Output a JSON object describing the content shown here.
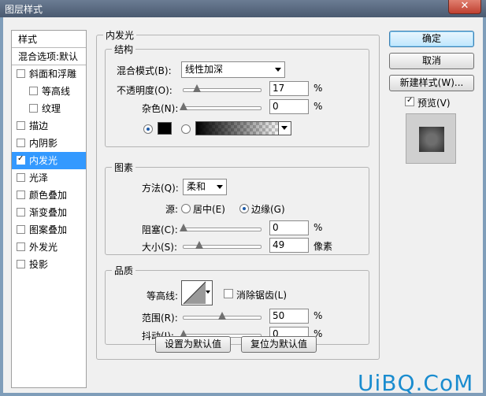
{
  "window": {
    "title": "图层样式",
    "close_glyph": "✕"
  },
  "styles_list": {
    "header": "样式",
    "blend_options": "混合选项:默认",
    "items": [
      {
        "label": "斜面和浮雕",
        "checked": false,
        "sub": false
      },
      {
        "label": "等高线",
        "checked": false,
        "sub": true
      },
      {
        "label": "纹理",
        "checked": false,
        "sub": true
      },
      {
        "label": "描边",
        "checked": false,
        "sub": false
      },
      {
        "label": "内阴影",
        "checked": false,
        "sub": false
      },
      {
        "label": "内发光",
        "checked": true,
        "sub": false,
        "selected": true
      },
      {
        "label": "光泽",
        "checked": false,
        "sub": false
      },
      {
        "label": "颜色叠加",
        "checked": false,
        "sub": false
      },
      {
        "label": "渐变叠加",
        "checked": false,
        "sub": false
      },
      {
        "label": "图案叠加",
        "checked": false,
        "sub": false
      },
      {
        "label": "外发光",
        "checked": false,
        "sub": false
      },
      {
        "label": "投影",
        "checked": false,
        "sub": false
      }
    ]
  },
  "panel": {
    "title": "内发光",
    "structure": {
      "legend": "结构",
      "blend_mode_label": "混合模式(B):",
      "blend_mode_value": "线性加深",
      "opacity_label": "不透明度(O):",
      "opacity_value": "17",
      "opacity_unit": "%",
      "opacity_fraction": 0.17,
      "noise_label": "杂色(N):",
      "noise_value": "0",
      "noise_unit": "%",
      "noise_fraction": 0.0,
      "color_swatch": "#000000"
    },
    "elements": {
      "legend": "图素",
      "technique_label": "方法(Q):",
      "technique_value": "柔和",
      "source_label": "源:",
      "source_center": "居中(E)",
      "source_edge": "边缘(G)",
      "choke_label": "阻塞(C):",
      "choke_value": "0",
      "choke_unit": "%",
      "choke_fraction": 0.0,
      "size_label": "大小(S):",
      "size_value": "49",
      "size_unit": "像素",
      "size_fraction": 0.2
    },
    "quality": {
      "legend": "品质",
      "contour_label": "等高线:",
      "antialias_label": "消除锯齿(L)",
      "range_label": "范围(R):",
      "range_value": "50",
      "range_unit": "%",
      "range_fraction": 0.5,
      "jitter_label": "抖动(J):",
      "jitter_value": "0",
      "jitter_unit": "%",
      "jitter_fraction": 0.0
    },
    "make_default": "设置为默认值",
    "reset_default": "复位为默认值"
  },
  "buttons": {
    "ok": "确定",
    "cancel": "取消",
    "new_style": "新建样式(W)...",
    "preview_label": "预览(V)",
    "preview_checked": true
  },
  "watermark": "UiBQ.CoM"
}
